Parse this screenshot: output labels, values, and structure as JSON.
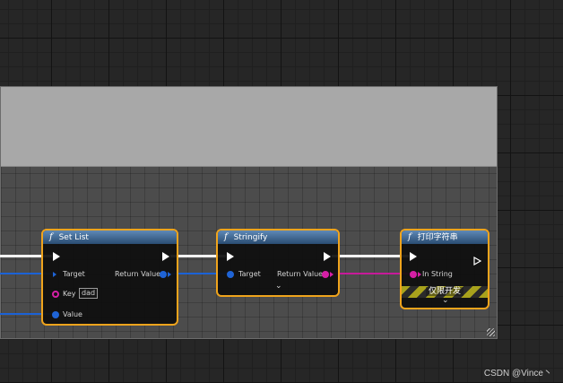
{
  "nodes": {
    "set_list": {
      "fn_symbol": "f",
      "title": "Set List",
      "target_label": "Target",
      "return_label": "Return Value",
      "key_label": "Key",
      "key_value": "dad",
      "value_label": "Value"
    },
    "stringify": {
      "fn_symbol": "f",
      "title": "Stringify",
      "target_label": "Target",
      "return_label": "Return Value",
      "expand_glyph": "⌄"
    },
    "print_string": {
      "fn_symbol": "f",
      "title": "打印字符串",
      "in_string_label": "In String",
      "dev_only_label": "仅限开发",
      "expand_glyph": "⌄"
    }
  },
  "colors": {
    "node_border": "#f0a41c",
    "header": "#4a75a3",
    "exec_wire": "#f2f2f2",
    "object_pin": "#1f64d6",
    "string_pin": "#d51fa6"
  },
  "watermark": "CSDN @Vince丶"
}
